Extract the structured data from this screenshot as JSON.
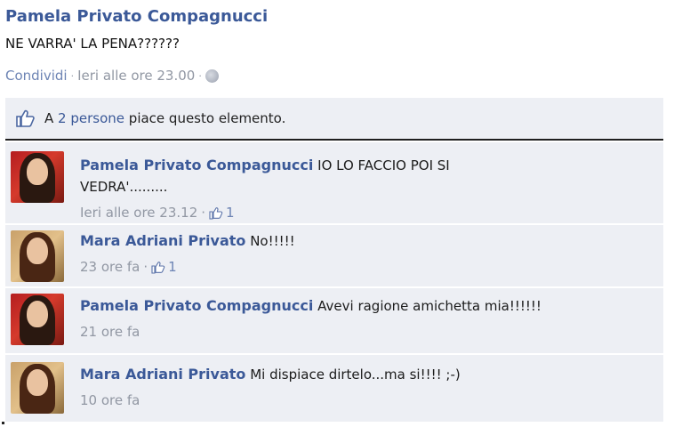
{
  "post": {
    "author": "Pamela Privato Compagnucci",
    "message": "NE VARRA' LA PENA??????",
    "share_label": "Condividi",
    "separator": "·",
    "timestamp": "Ieri alle ore 23.00",
    "audience_icon": "globe-icon"
  },
  "likes": {
    "prefix": "A",
    "count_link": "2 persone",
    "suffix": "piace questo elemento."
  },
  "comments": [
    {
      "author": "Pamela Privato Compagnucci",
      "text_line1": "IO LO FACCIO POI SI",
      "text_line2": "VEDRA'.........",
      "time": "Ieri alle ore 23.12",
      "likes": "1",
      "avatar": "red"
    },
    {
      "author": "Mara Adriani Privato",
      "text": "No!!!!!",
      "time": "23 ore fa",
      "likes": "1",
      "avatar": "gold"
    },
    {
      "author": "Pamela Privato Compagnucci",
      "text": "Avevi ragione amichetta mia!!!!!!",
      "time": "21 ore fa",
      "avatar": "red"
    },
    {
      "author": "Mara Adriani Privato",
      "text": "Mi dispiace dirtelo...ma si!!!! ;-)",
      "time": "10 ore fa",
      "avatar": "gold"
    }
  ],
  "colors": {
    "link": "#3b5998",
    "meta": "#9197a3",
    "panel": "#edeff4"
  }
}
